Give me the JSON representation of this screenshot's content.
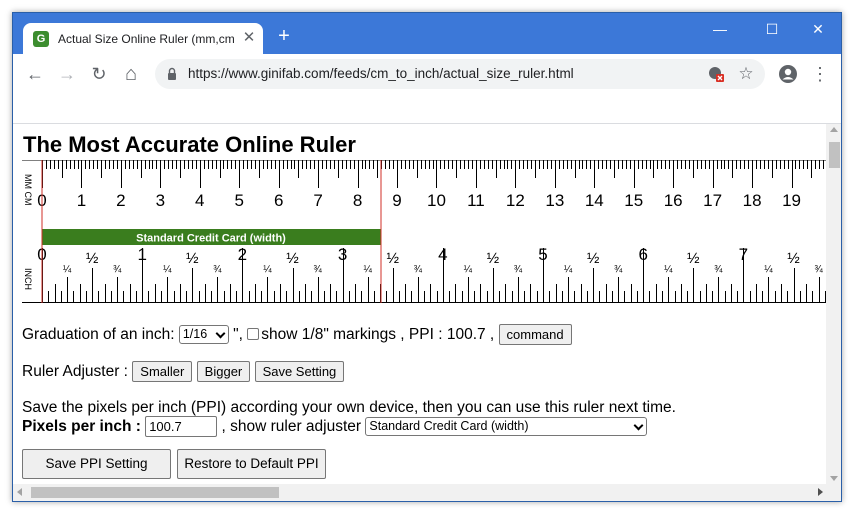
{
  "browser": {
    "tab_title": "Actual Size Online Ruler (mm,cm",
    "favicon_letter": "G",
    "url": "https://www.ginifab.com/feeds/cm_to_inch/actual_size_ruler.html",
    "close_glyph": "✕",
    "new_tab_glyph": "+",
    "minimize_glyph": "—",
    "maximize_glyph": "☐",
    "window_close_glyph": "✕",
    "back_glyph": "←",
    "forward_glyph": "→",
    "reload_glyph": "↻",
    "home_glyph": "⌂",
    "star_glyph": "☆",
    "menu_glyph": "⋮",
    "icons": [
      "back-arrow-icon",
      "forward-arrow-icon",
      "reload-icon",
      "home-icon",
      "lock-icon",
      "blocked-content-icon",
      "star-icon",
      "profile-icon",
      "kebab-menu-icon"
    ]
  },
  "page": {
    "title": "The Most Accurate Online Ruler"
  },
  "ruler": {
    "top_scale_label": "MM CM",
    "bottom_scale_label": "INCH",
    "cm_labels": [
      "0",
      "1",
      "2",
      "3",
      "4",
      "5",
      "6",
      "7",
      "8",
      "9",
      "10",
      "11",
      "12",
      "13",
      "14",
      "15",
      "16",
      "17",
      "18",
      "19"
    ],
    "inch_labels": [
      "0",
      "1",
      "2",
      "3",
      "4",
      "5",
      "6",
      "7"
    ],
    "fraction_quarter": "¼",
    "fraction_half": "½",
    "fraction_three_quarter": "¾",
    "credit_card_label": "Standard Credit Card (width)",
    "credit_card_color": "#3a7d1e",
    "marker_line_color": "#d22f27",
    "ppi": 100.7
  },
  "controls": {
    "graduation_label": "Graduation of an inch:",
    "graduation_value": "1/16",
    "inch_mark": "\",",
    "show_markings_label": "show 1/8\" markings , PPI : 100.7 ,",
    "command_button": "command",
    "adjuster_label": "Ruler Adjuster :",
    "smaller_button": "Smaller",
    "bigger_button": "Bigger",
    "save_setting_button": "Save Setting",
    "save_ppi_text": "Save the pixels per inch (PPI) according your own device, then you can use this ruler next time.",
    "ppi_label": "Pixels per inch :",
    "ppi_value": "100.7",
    "show_adjuster_label": ", show ruler adjuster",
    "adjuster_select_value": "Standard Credit Card (width)",
    "save_ppi_button": "Save PPI Setting",
    "restore_ppi_button": "Restore to Default PPI"
  }
}
